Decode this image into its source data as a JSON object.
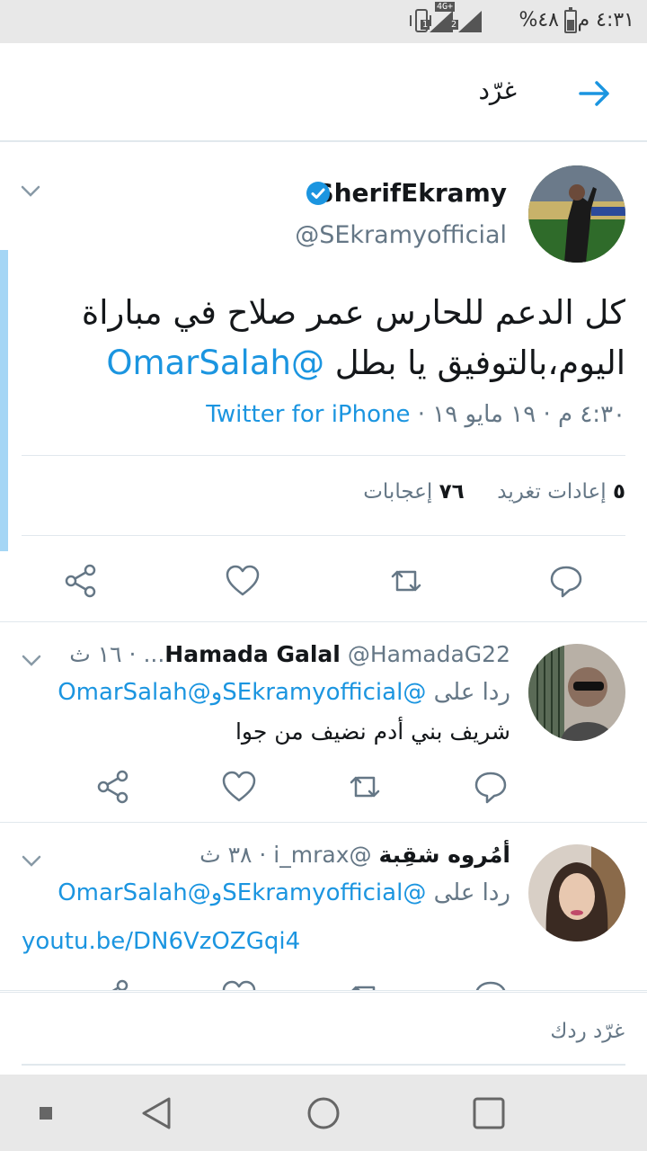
{
  "status_bar": {
    "time": "٤:٣١ م",
    "battery": "٤٨%",
    "network_tag": "4G+",
    "sim1": "1",
    "sim2": "2"
  },
  "header": {
    "title": "غرّد"
  },
  "main_tweet": {
    "name": "SherifEkramy",
    "handle": "@SEkramyofficial",
    "text": "كل الدعم للحارس عمر صلاح في مباراة اليوم،بالتوفيق يا بطل",
    "mention": "@OmarSalah",
    "meta_date": "٤:٣٠ م · ١٩ مايو ١٩ · ",
    "source": "Twitter for iPhone",
    "retweets_count": "٥",
    "retweets_label": "إعادات تغريد",
    "likes_count": "٧٦",
    "likes_label": "إعجابات"
  },
  "replies": [
    {
      "name": "Hamada Galal",
      "handle": "@HamadaG22...",
      "time": "١٦ ث",
      "replying_label": "ردا على",
      "mention1": "@SEkramyofficial",
      "and": "و",
      "mention2": "@OmarSalah",
      "text": "شريف بني أدم نضيف من جوا"
    },
    {
      "name": "أمُروه شقِبة",
      "handle": "@i_mrax",
      "time": "٣٨ ث",
      "replying_label": "ردا على",
      "mention1": "@SEkramyofficial",
      "and": "و",
      "mention2": "@OmarSalah",
      "link": "youtu.be/DN6VzOZGqi4"
    }
  ],
  "compose": {
    "placeholder": "غرّد ردك"
  },
  "colors": {
    "accent": "#1b95e0",
    "secondary_text": "#657786",
    "divider": "#e1e8ed"
  }
}
